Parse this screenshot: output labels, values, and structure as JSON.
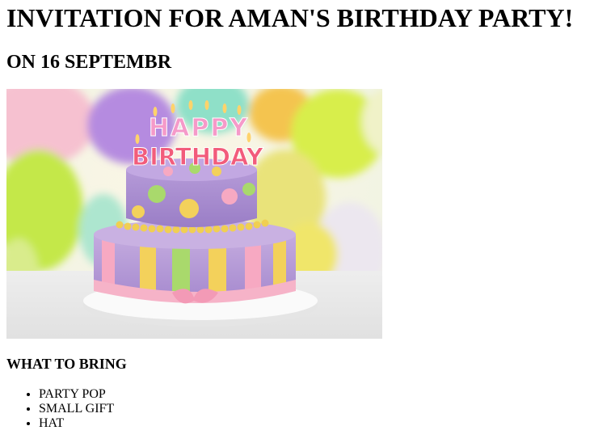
{
  "heading": "INVITATION FOR AMAN'S BIRTHDAY PARTY!",
  "date_heading": "ON 16 SEPTEMBR",
  "image": {
    "subject": "birthday-cake-photo",
    "cake_topper_line1": "HAPPY",
    "cake_topper_line2": "BIRTHDAY"
  },
  "bring_heading": "WHAT TO BRING",
  "bring_items": [
    "PARTY POP",
    "SMALL GIFT",
    "HAT"
  ]
}
